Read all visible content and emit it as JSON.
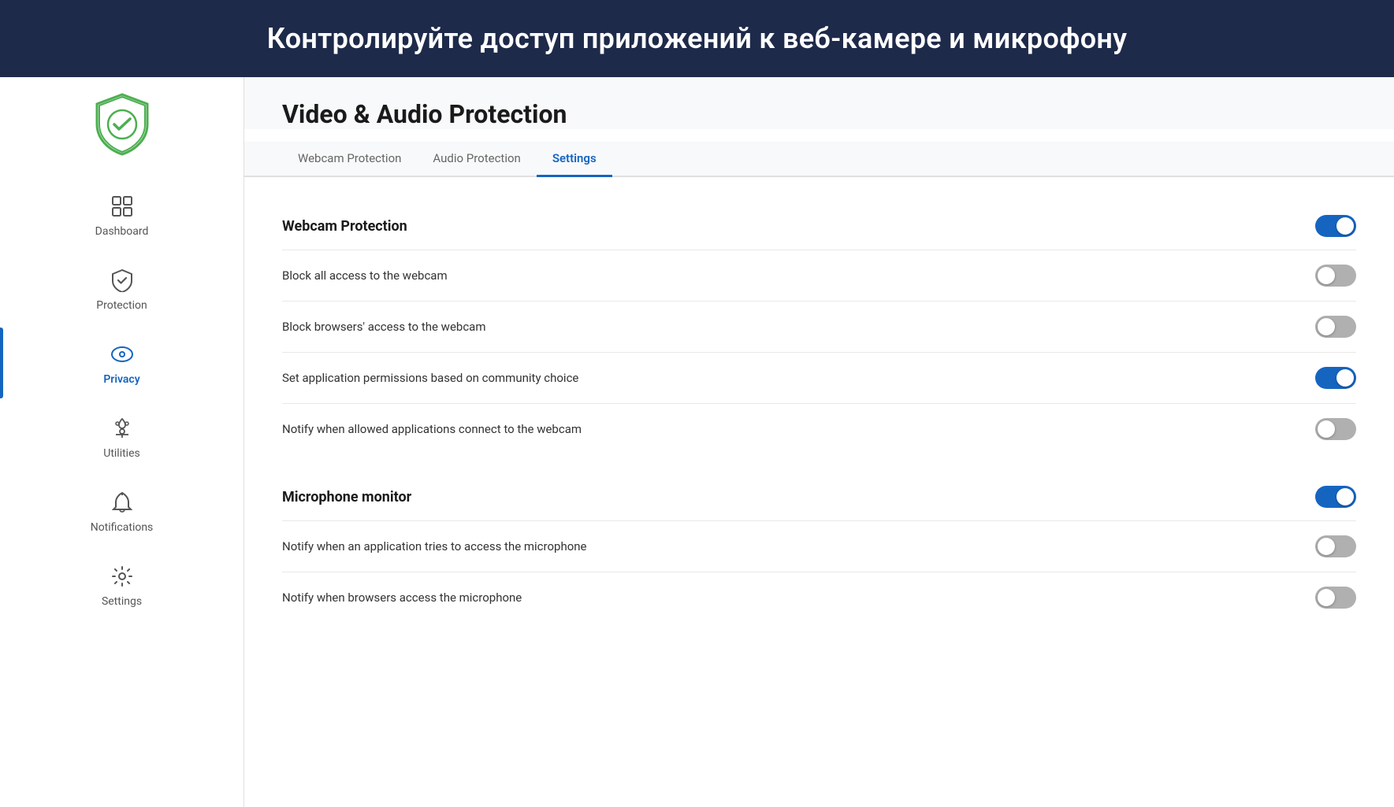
{
  "banner": {
    "text": "Контролируйте доступ приложений к веб-камере и микрофону"
  },
  "sidebar": {
    "logo_alt": "Kaspersky Shield Logo",
    "nav_items": [
      {
        "id": "dashboard",
        "label": "Dashboard",
        "active": false
      },
      {
        "id": "protection",
        "label": "Protection",
        "active": false
      },
      {
        "id": "privacy",
        "label": "Privacy",
        "active": true
      },
      {
        "id": "utilities",
        "label": "Utilities",
        "active": false
      },
      {
        "id": "notifications",
        "label": "Notifications",
        "active": false
      },
      {
        "id": "settings",
        "label": "Settings",
        "active": false
      }
    ]
  },
  "content": {
    "page_title": "Video & Audio Protection",
    "tabs": [
      {
        "id": "webcam-protection",
        "label": "Webcam Protection",
        "active": false
      },
      {
        "id": "audio-protection",
        "label": "Audio Protection",
        "active": false
      },
      {
        "id": "settings",
        "label": "Settings",
        "active": true
      }
    ],
    "webcam_section": {
      "title": "Webcam Protection",
      "title_toggle": true,
      "rows": [
        {
          "id": "block-all-webcam",
          "label": "Block all access to the webcam",
          "enabled": false
        },
        {
          "id": "block-browsers-webcam",
          "label": "Block browsers' access to the webcam",
          "enabled": false
        },
        {
          "id": "community-choice",
          "label": "Set application permissions based on community choice",
          "enabled": true
        },
        {
          "id": "notify-allowed-webcam",
          "label": "Notify when allowed applications connect to the webcam",
          "enabled": false
        }
      ]
    },
    "microphone_section": {
      "title": "Microphone monitor",
      "title_toggle": true,
      "rows": [
        {
          "id": "notify-app-mic",
          "label": "Notify when an application tries to access the microphone",
          "enabled": false
        },
        {
          "id": "notify-browsers-mic",
          "label": "Notify when browsers access the microphone",
          "enabled": false
        }
      ]
    }
  }
}
